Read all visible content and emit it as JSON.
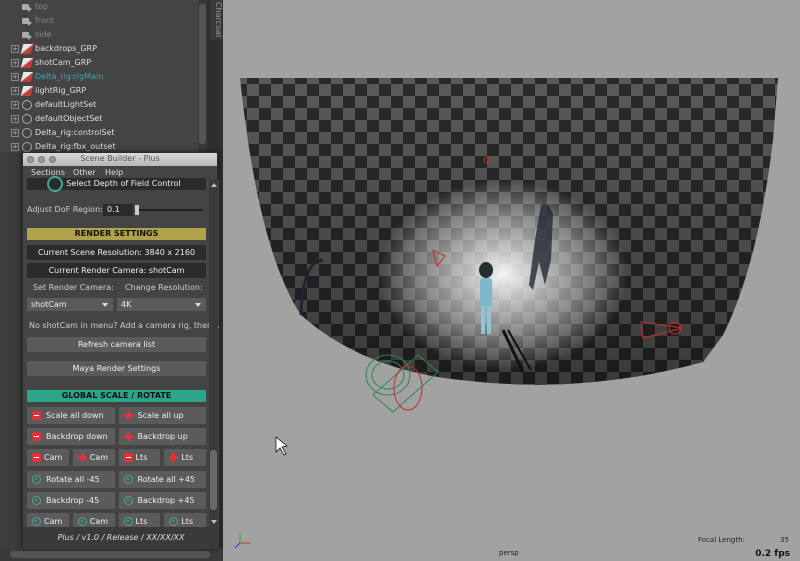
{
  "outliner": {
    "items": [
      {
        "label": "top",
        "style": "dim",
        "icon": "camera-icon"
      },
      {
        "label": "front",
        "style": "dim",
        "icon": "camera-icon"
      },
      {
        "label": "side",
        "style": "dim",
        "icon": "camera-icon"
      },
      {
        "label": "backdrops_GRP",
        "style": "normal",
        "icon": "group-icon"
      },
      {
        "label": "shotCam_GRP",
        "style": "normal",
        "icon": "group-icon"
      },
      {
        "label": "Delta_rig:rigMain",
        "style": "teal",
        "icon": "group-icon"
      },
      {
        "label": "lightRig_GRP",
        "style": "normal",
        "icon": "group-icon"
      },
      {
        "label": "defaultLightSet",
        "style": "normal",
        "icon": "set-icon"
      },
      {
        "label": "defaultObjectSet",
        "style": "normal",
        "icon": "set-icon"
      },
      {
        "label": "Delta_rig:controlSet",
        "style": "normal",
        "icon": "set-icon"
      },
      {
        "label": "Delta_rig:fbx_outset",
        "style": "normal",
        "icon": "set-icon"
      }
    ],
    "panel_tab": "Charcoal"
  },
  "window": {
    "title": "Scene Builder - Plus",
    "menu": [
      "Sections",
      "Other",
      "Help"
    ],
    "dof_button": "Select Depth of Field Control",
    "dof_label": "Adjust DoF Region:",
    "dof_value": "0.1",
    "render_header": "RENDER SETTINGS",
    "scene_resolution": "Current Scene Resolution: 3840 x 2160",
    "render_camera": "Current Render Camera: shotCam",
    "set_camera_label": "Set Render Camera:",
    "change_res_label": "Change Resolution:",
    "camera_value": "shotCam",
    "resolution_value": "4K",
    "hint": "No shotCam in menu? Add a camera rig, then...",
    "refresh_button": "Refresh camera list",
    "maya_render_button": "Maya Render Settings",
    "global_header": "GLOBAL SCALE / ROTATE",
    "buttons": [
      [
        {
          "label": "Scale all down",
          "icon": "minus"
        },
        {
          "label": "Scale all up",
          "icon": "plus"
        }
      ],
      [
        {
          "label": "Backdrop down",
          "icon": "minus"
        },
        {
          "label": "Backdrop up",
          "icon": "plus"
        }
      ],
      [
        {
          "label": "Cam",
          "icon": "minus"
        },
        {
          "label": "Cam",
          "icon": "plus"
        },
        {
          "label": "Lts",
          "icon": "minus"
        },
        {
          "label": "Lts",
          "icon": "plus"
        }
      ],
      [
        {
          "label": "Rotate all -45",
          "icon": "rotate"
        },
        {
          "label": "Rotate all +45",
          "icon": "rotate"
        }
      ],
      [
        {
          "label": "Backdrop -45",
          "icon": "rotate"
        },
        {
          "label": "Backdrop +45",
          "icon": "rotate"
        }
      ],
      [
        {
          "label": "Cam",
          "icon": "rotate"
        },
        {
          "label": "Cam",
          "icon": "rotate"
        },
        {
          "label": "Lts",
          "icon": "rotate"
        },
        {
          "label": "Lts",
          "icon": "rotate"
        }
      ]
    ],
    "footer": "Plus  /  v1.0  /  Release  /  XX/XX/XX",
    "colors": {
      "render_header": "#b0a24a",
      "global_header": "#2aa58a"
    }
  },
  "viewport": {
    "camera": "persp",
    "focal_length_label": "Focal Length:",
    "focal_length_value": "35",
    "fps": "0.2 fps"
  }
}
